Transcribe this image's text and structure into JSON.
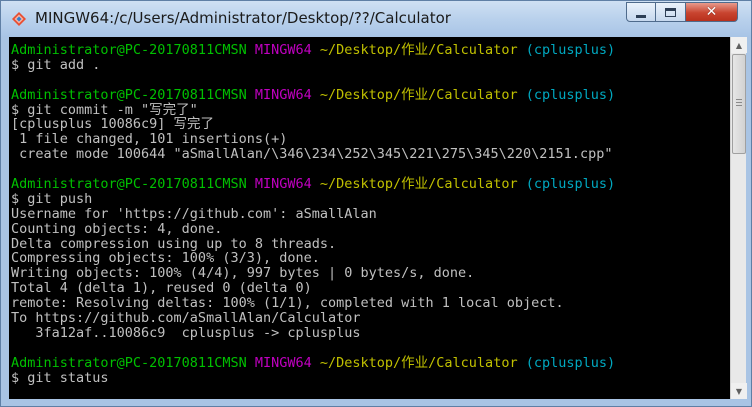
{
  "window": {
    "title": "MINGW64:/c/Users/Administrator/Desktop/??/Calculator",
    "icon": "git-bash-icon",
    "controls": {
      "minimize_icon": "minimize-icon",
      "maximize_icon": "maximize-icon",
      "close_label": "✕"
    }
  },
  "colors": {
    "user_host": "#00c000",
    "msystem": "#c000c0",
    "path": "#c0c000",
    "branch": "#00a8c0",
    "text": "#c0c0c0",
    "background": "#000000"
  },
  "terminal": {
    "lines": [
      {
        "type": "prompt",
        "user": "Administrator@PC-20170811CMSN",
        "msystem": "MINGW64",
        "path": "~/Desktop/作业/Calculator",
        "branch": "(cplusplus)"
      },
      {
        "type": "text",
        "text": "$ git add ."
      },
      {
        "type": "blank",
        "text": ""
      },
      {
        "type": "prompt",
        "user": "Administrator@PC-20170811CMSN",
        "msystem": "MINGW64",
        "path": "~/Desktop/作业/Calculator",
        "branch": "(cplusplus)"
      },
      {
        "type": "text",
        "text": "$ git commit -m \"写完了\""
      },
      {
        "type": "text",
        "text": "[cplusplus 10086c9] 写完了"
      },
      {
        "type": "text",
        "text": " 1 file changed, 101 insertions(+)"
      },
      {
        "type": "text",
        "text": " create mode 100644 \"aSmallAlan/\\346\\234\\252\\345\\221\\275\\345\\220\\2151.cpp\""
      },
      {
        "type": "blank",
        "text": ""
      },
      {
        "type": "prompt",
        "user": "Administrator@PC-20170811CMSN",
        "msystem": "MINGW64",
        "path": "~/Desktop/作业/Calculator",
        "branch": "(cplusplus)"
      },
      {
        "type": "text",
        "text": "$ git push"
      },
      {
        "type": "text",
        "text": "Username for 'https://github.com': aSmallAlan"
      },
      {
        "type": "text",
        "text": "Counting objects: 4, done."
      },
      {
        "type": "text",
        "text": "Delta compression using up to 8 threads."
      },
      {
        "type": "text",
        "text": "Compressing objects: 100% (3/3), done."
      },
      {
        "type": "text",
        "text": "Writing objects: 100% (4/4), 997 bytes | 0 bytes/s, done."
      },
      {
        "type": "text",
        "text": "Total 4 (delta 1), reused 0 (delta 0)"
      },
      {
        "type": "text",
        "text": "remote: Resolving deltas: 100% (1/1), completed with 1 local object."
      },
      {
        "type": "text",
        "text": "To https://github.com/aSmallAlan/Calculator"
      },
      {
        "type": "text",
        "text": "   3fa12af..10086c9  cplusplus -> cplusplus"
      },
      {
        "type": "blank",
        "text": ""
      },
      {
        "type": "prompt",
        "user": "Administrator@PC-20170811CMSN",
        "msystem": "MINGW64",
        "path": "~/Desktop/作业/Calculator",
        "branch": "(cplusplus)"
      },
      {
        "type": "text",
        "text": "$ git status"
      }
    ]
  },
  "scrollbar": {
    "up_arrow": "▲",
    "down_arrow": "▼"
  }
}
